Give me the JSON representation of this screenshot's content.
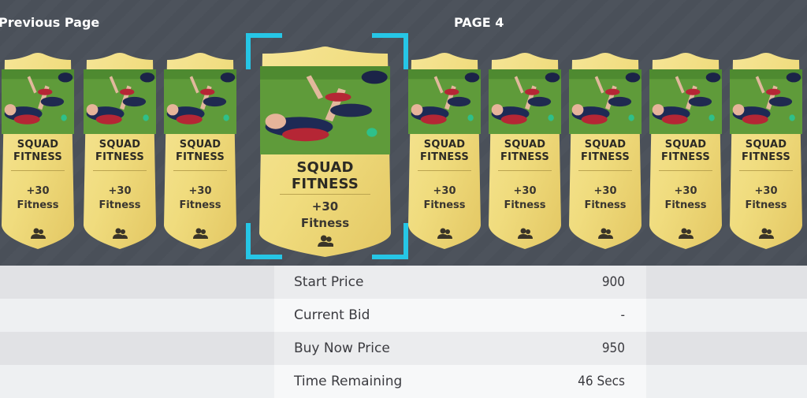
{
  "nav": {
    "previous_label": "Previous Page",
    "page_label": "PAGE 4"
  },
  "card": {
    "title": "SQUAD\nFITNESS",
    "value": "+30",
    "attribute": "Fitness",
    "icon": "people-icon"
  },
  "cards_count_note": "10 cards visible, 4th selected",
  "colors": {
    "card_gold": "#f3df84",
    "selection": "#26c6e6",
    "background": "#4a5059"
  },
  "details": [
    {
      "label": "Start Price",
      "value": "900"
    },
    {
      "label": "Current Bid",
      "value": "-"
    },
    {
      "label": "Buy Now Price",
      "value": "950"
    },
    {
      "label": "Time Remaining",
      "value": "46 Secs"
    }
  ]
}
